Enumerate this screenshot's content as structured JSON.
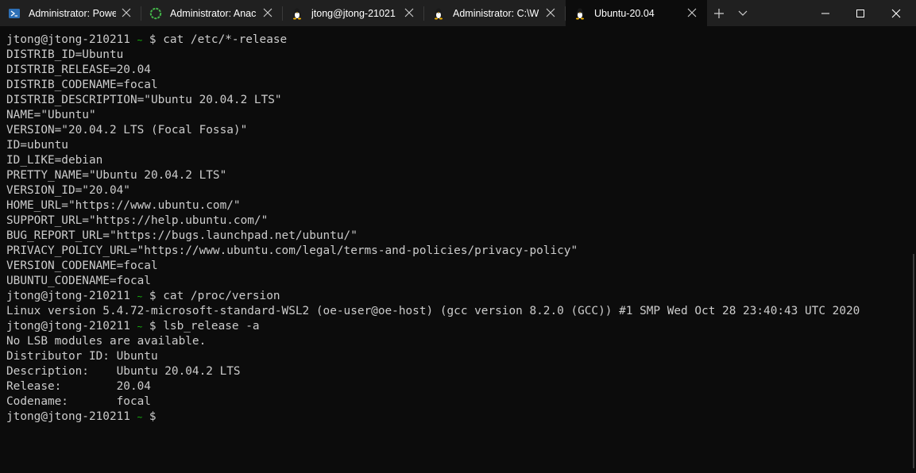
{
  "tabs": [
    {
      "title": "Administrator: Powe",
      "icon": "powershell-icon",
      "active": false
    },
    {
      "title": "Administrator: Anac",
      "icon": "anaconda-icon",
      "active": false
    },
    {
      "title": "jtong@jtong-21021",
      "icon": "linux-tux-icon",
      "active": false
    },
    {
      "title": "Administrator: C:\\W",
      "icon": "linux-tux-icon",
      "active": false
    },
    {
      "title": "Ubuntu-20.04",
      "icon": "linux-tux-icon",
      "active": true
    }
  ],
  "colors": {
    "prompt_tilde": "#16c60c",
    "text": "#cccccc",
    "background": "#0c0c0c",
    "titlebar": "#202020"
  },
  "terminal": {
    "prompt_user": "jtong@jtong-210211",
    "prompt_tilde": "~",
    "prompt_symbol": "$",
    "lines": [
      {
        "type": "prompt",
        "cmd": "cat /etc/*-release"
      },
      {
        "type": "out",
        "text": "DISTRIB_ID=Ubuntu"
      },
      {
        "type": "out",
        "text": "DISTRIB_RELEASE=20.04"
      },
      {
        "type": "out",
        "text": "DISTRIB_CODENAME=focal"
      },
      {
        "type": "out",
        "text": "DISTRIB_DESCRIPTION=\"Ubuntu 20.04.2 LTS\""
      },
      {
        "type": "out",
        "text": "NAME=\"Ubuntu\""
      },
      {
        "type": "out",
        "text": "VERSION=\"20.04.2 LTS (Focal Fossa)\""
      },
      {
        "type": "out",
        "text": "ID=ubuntu"
      },
      {
        "type": "out",
        "text": "ID_LIKE=debian"
      },
      {
        "type": "out",
        "text": "PRETTY_NAME=\"Ubuntu 20.04.2 LTS\""
      },
      {
        "type": "out",
        "text": "VERSION_ID=\"20.04\""
      },
      {
        "type": "out",
        "text": "HOME_URL=\"https://www.ubuntu.com/\""
      },
      {
        "type": "out",
        "text": "SUPPORT_URL=\"https://help.ubuntu.com/\""
      },
      {
        "type": "out",
        "text": "BUG_REPORT_URL=\"https://bugs.launchpad.net/ubuntu/\""
      },
      {
        "type": "out",
        "text": "PRIVACY_POLICY_URL=\"https://www.ubuntu.com/legal/terms-and-policies/privacy-policy\""
      },
      {
        "type": "out",
        "text": "VERSION_CODENAME=focal"
      },
      {
        "type": "out",
        "text": "UBUNTU_CODENAME=focal"
      },
      {
        "type": "prompt",
        "cmd": "cat /proc/version"
      },
      {
        "type": "out",
        "text": "Linux version 5.4.72-microsoft-standard-WSL2 (oe-user@oe-host) (gcc version 8.2.0 (GCC)) #1 SMP Wed Oct 28 23:40:43 UTC 2020"
      },
      {
        "type": "prompt",
        "cmd": "lsb_release -a"
      },
      {
        "type": "out",
        "text": "No LSB modules are available."
      },
      {
        "type": "out",
        "text": "Distributor ID: Ubuntu"
      },
      {
        "type": "out",
        "text": "Description:    Ubuntu 20.04.2 LTS"
      },
      {
        "type": "out",
        "text": "Release:        20.04"
      },
      {
        "type": "out",
        "text": "Codename:       focal"
      },
      {
        "type": "prompt",
        "cmd": ""
      }
    ]
  }
}
